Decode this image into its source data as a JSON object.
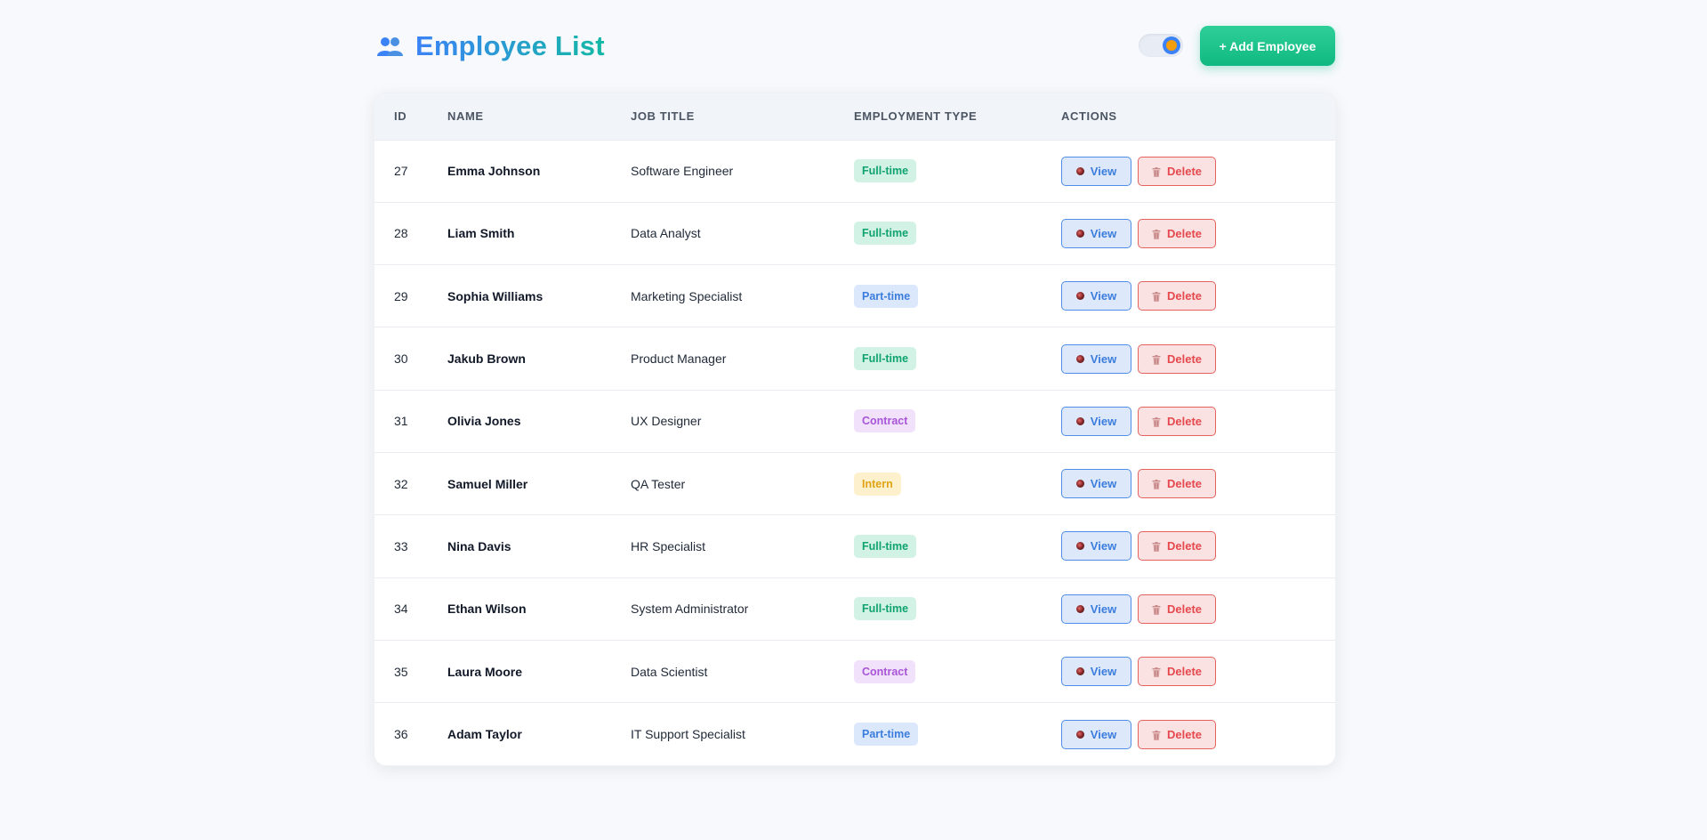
{
  "header": {
    "title": "Employee List",
    "title_icon": "people-icon",
    "add_button_label": "+ Add Employee",
    "theme_toggle_icon": "theme-toggle-icon"
  },
  "colors": {
    "title_gradient_start": "#3b82f6",
    "title_gradient_end": "#14b8a6",
    "add_button": "#10b981",
    "view_button": "#3b7ddd",
    "delete_button": "#e5484d"
  },
  "table": {
    "columns": [
      "ID",
      "NAME",
      "JOB TITLE",
      "EMPLOYMENT TYPE",
      "ACTIONS"
    ],
    "view_label": "View",
    "delete_label": "Delete",
    "rows": [
      {
        "id": "27",
        "name": "Emma Johnson",
        "job_title": "Software Engineer",
        "type": "Full-time",
        "type_key": "fulltime"
      },
      {
        "id": "28",
        "name": "Liam Smith",
        "job_title": "Data Analyst",
        "type": "Full-time",
        "type_key": "fulltime"
      },
      {
        "id": "29",
        "name": "Sophia Williams",
        "job_title": "Marketing Specialist",
        "type": "Part-time",
        "type_key": "parttime"
      },
      {
        "id": "30",
        "name": "Jakub Brown",
        "job_title": "Product Manager",
        "type": "Full-time",
        "type_key": "fulltime"
      },
      {
        "id": "31",
        "name": "Olivia Jones",
        "job_title": "UX Designer",
        "type": "Contract",
        "type_key": "contract"
      },
      {
        "id": "32",
        "name": "Samuel Miller",
        "job_title": "QA Tester",
        "type": "Intern",
        "type_key": "intern"
      },
      {
        "id": "33",
        "name": "Nina Davis",
        "job_title": "HR Specialist",
        "type": "Full-time",
        "type_key": "fulltime"
      },
      {
        "id": "34",
        "name": "Ethan Wilson",
        "job_title": "System Administrator",
        "type": "Full-time",
        "type_key": "fulltime"
      },
      {
        "id": "35",
        "name": "Laura Moore",
        "job_title": "Data Scientist",
        "type": "Contract",
        "type_key": "contract"
      },
      {
        "id": "36",
        "name": "Adam Taylor",
        "job_title": "IT Support Specialist",
        "type": "Part-time",
        "type_key": "parttime"
      }
    ]
  }
}
